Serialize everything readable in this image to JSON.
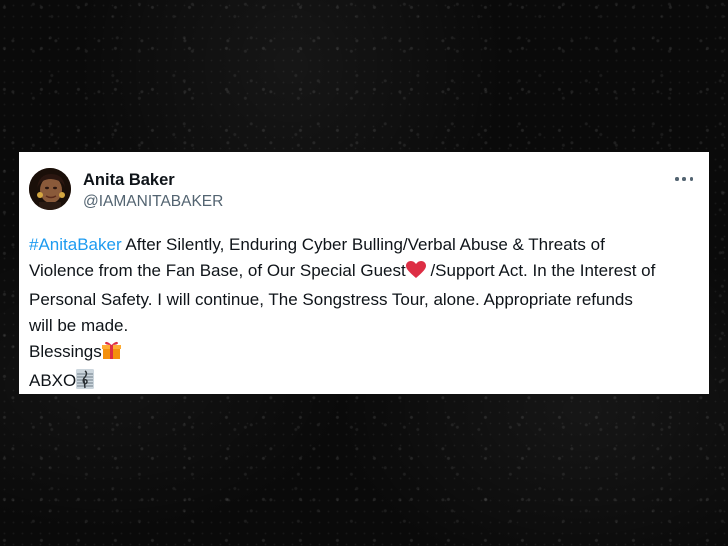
{
  "tweet": {
    "display_name": "Anita Baker",
    "handle": "@IAMANITABAKER",
    "hashtag": "#AnitaBaker",
    "text_line1": " After Silently, Enduring Cyber Bulling/Verbal Abuse & Threats of",
    "text_line2a": "Violence from the Fan Base, of Our Special Guest",
    "text_line2b": " /Support Act. In the Interest of",
    "text_line3": "Personal Safety. I will continue, The Songstress Tour, alone. Appropriate refunds",
    "text_line4": "will be made.",
    "blessings": "Blessings",
    "signoff": "ABXO",
    "colors": {
      "hashtag": "#1d9bf0",
      "text": "#0f1419",
      "secondary": "#536471"
    },
    "icons": {
      "more": "more-horizontal-icon",
      "heart": "red-heart-icon",
      "gift": "gift-icon",
      "music": "musical-score-icon"
    }
  }
}
